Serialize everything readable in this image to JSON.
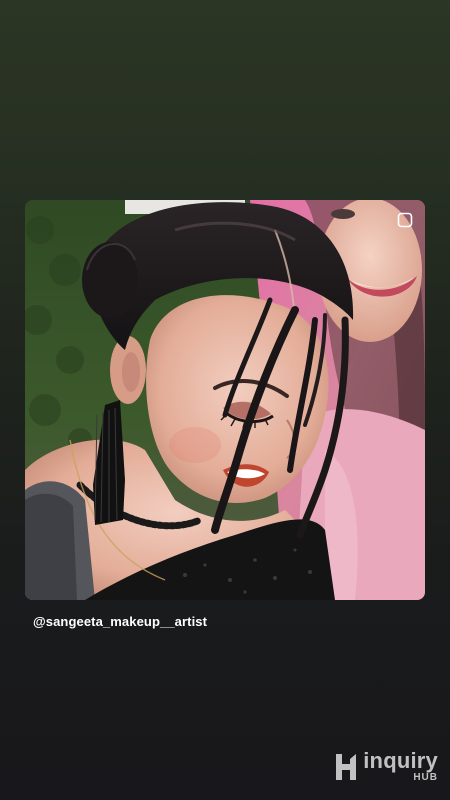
{
  "story": {
    "mention_handle": "@sangeeta_makeup__artist",
    "photo_subject": "portrait-photo",
    "multiple_photos_indicator": "multi-photo-icon"
  },
  "watermark": {
    "brand_word": "inquiry",
    "brand_sub": "HUB",
    "icon": "hub-logo-icon"
  },
  "colors": {
    "background_top": "#2c3624",
    "background_bottom": "#18171b",
    "handle_text": "#ffffff",
    "watermark_text": "#d9d9d9"
  }
}
